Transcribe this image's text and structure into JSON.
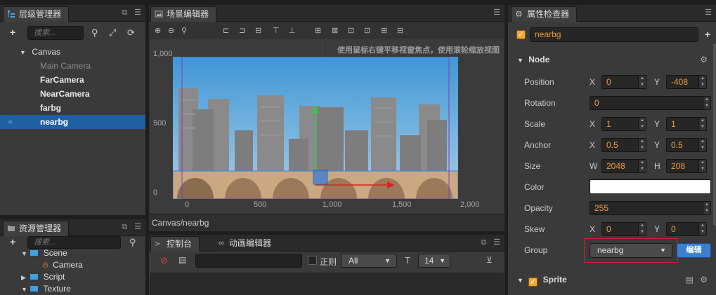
{
  "hierarchy": {
    "tab_label": "层级管理器",
    "search_placeholder": "搜索...",
    "root": "Canvas",
    "items": [
      "Main Camera",
      "FarCamera",
      "NearCamera",
      "farbg",
      "nearbg"
    ],
    "selected": "nearbg"
  },
  "assets": {
    "tab_label": "资源管理器",
    "search_placeholder": "搜索...",
    "items": [
      {
        "label": "Scene",
        "type": "folder"
      },
      {
        "label": "Camera",
        "type": "scene"
      },
      {
        "label": "Script",
        "type": "folder"
      },
      {
        "label": "Texture",
        "type": "folder"
      }
    ]
  },
  "scene": {
    "tab_label": "场景编辑器",
    "hint": "使用鼠标右键平移视窗焦点，使用滚轮缩放视图",
    "y_ticks": [
      "1,000",
      "500",
      "0"
    ],
    "x_ticks": [
      "0",
      "500",
      "1,000",
      "1,500",
      "2,000"
    ],
    "breadcrumb": "Canvas/nearbg"
  },
  "console": {
    "tab_console": "控制台",
    "tab_anim": "动画编辑器",
    "regex_label": "正则",
    "filter_value": "All",
    "font_size": "14"
  },
  "inspector": {
    "tab_label": "属性检查器",
    "node_name": "nearbg",
    "section_node": "Node",
    "position": {
      "label": "Position",
      "x": "0",
      "y": "-408"
    },
    "rotation": {
      "label": "Rotation",
      "value": "0"
    },
    "scale": {
      "label": "Scale",
      "x": "1",
      "y": "1"
    },
    "anchor": {
      "label": "Anchor",
      "x": "0.5",
      "y": "0.5"
    },
    "size": {
      "label": "Size",
      "w": "2048",
      "h": "208"
    },
    "color": {
      "label": "Color",
      "value": "#ffffff"
    },
    "opacity": {
      "label": "Opacity",
      "value": "255"
    },
    "skew": {
      "label": "Skew",
      "x": "0",
      "y": "0"
    },
    "group": {
      "label": "Group",
      "value": "nearbg",
      "edit_label": "编辑"
    },
    "section_sprite": "Sprite",
    "axis_x": "X",
    "axis_y": "Y",
    "axis_w": "W",
    "axis_h": "H"
  },
  "colors": {
    "accent": "#f3a637",
    "selected": "#1f5fa3",
    "edit_button": "#3a7fd0",
    "highlight_box": "#d02020"
  }
}
